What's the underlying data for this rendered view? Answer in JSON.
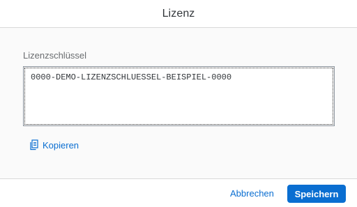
{
  "dialog": {
    "title": "Lizenz"
  },
  "license_field": {
    "label": "Lizenzschlüssel",
    "value": "0000-DEMO-LIZENZSCHLUESSEL-BEISPIEL-0000"
  },
  "copy_action": {
    "label": "Kopieren",
    "icon": "copy-icon"
  },
  "footer": {
    "cancel_label": "Abbrechen",
    "save_label": "Speichern"
  },
  "colors": {
    "accent": "#0a6ed1",
    "content_background": "#fafafa"
  }
}
